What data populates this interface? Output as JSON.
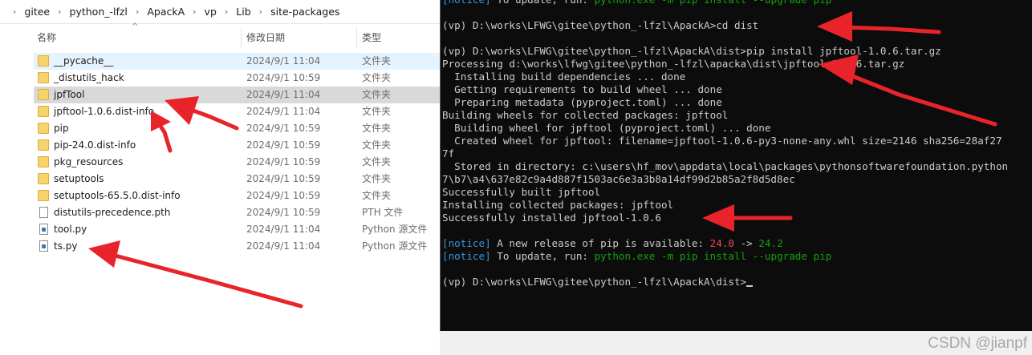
{
  "breadcrumb": [
    "gitee",
    "python_-lfzl",
    "ApackA",
    "vp",
    "Lib",
    "site-packages"
  ],
  "columns": {
    "name": "名称",
    "date": "修改日期",
    "type": "类型"
  },
  "files": [
    {
      "name": "__pycache__",
      "date": "2024/9/1 11:04",
      "type": "文件夹",
      "icon": "folder-icon",
      "state": "hover"
    },
    {
      "name": "_distutils_hack",
      "date": "2024/9/1 10:59",
      "type": "文件夹",
      "icon": "folder-icon",
      "state": ""
    },
    {
      "name": "jpfTool",
      "date": "2024/9/1 11:04",
      "type": "文件夹",
      "icon": "folder-icon",
      "state": "selected"
    },
    {
      "name": "jpftool-1.0.6.dist-info",
      "date": "2024/9/1 11:04",
      "type": "文件夹",
      "icon": "folder-icon",
      "state": ""
    },
    {
      "name": "pip",
      "date": "2024/9/1 10:59",
      "type": "文件夹",
      "icon": "folder-icon",
      "state": ""
    },
    {
      "name": "pip-24.0.dist-info",
      "date": "2024/9/1 10:59",
      "type": "文件夹",
      "icon": "folder-icon",
      "state": ""
    },
    {
      "name": "pkg_resources",
      "date": "2024/9/1 10:59",
      "type": "文件夹",
      "icon": "folder-icon",
      "state": ""
    },
    {
      "name": "setuptools",
      "date": "2024/9/1 10:59",
      "type": "文件夹",
      "icon": "folder-icon",
      "state": ""
    },
    {
      "name": "setuptools-65.5.0.dist-info",
      "date": "2024/9/1 10:59",
      "type": "文件夹",
      "icon": "folder-icon",
      "state": ""
    },
    {
      "name": "distutils-precedence.pth",
      "date": "2024/9/1 10:59",
      "type": "PTH 文件",
      "icon": "file-icon",
      "state": ""
    },
    {
      "name": "tool.py",
      "date": "2024/9/1 11:04",
      "type": "Python 源文件",
      "icon": "python-file-icon",
      "state": ""
    },
    {
      "name": "ts.py",
      "date": "2024/9/1 11:04",
      "type": "Python 源文件",
      "icon": "python-file-icon",
      "state": ""
    }
  ],
  "console": {
    "lines": [
      [
        {
          "t": "[notice]",
          "c": "cyan"
        },
        {
          "t": " To update, run: "
        },
        {
          "t": "python.exe -m pip install --upgrade pip",
          "c": "green"
        }
      ],
      [
        {
          "t": ""
        }
      ],
      [
        {
          "t": "(vp) D:\\works\\LFWG\\gitee\\python_-lfzl\\ApackA>cd dist"
        }
      ],
      [
        {
          "t": ""
        }
      ],
      [
        {
          "t": "(vp) D:\\works\\LFWG\\gitee\\python_-lfzl\\ApackA\\dist>pip install jpftool-1.0.6.tar.gz"
        }
      ],
      [
        {
          "t": "Processing d:\\works\\lfwg\\gitee\\python_-lfzl\\apacka\\dist\\jpftool-1.0.6.tar.gz"
        }
      ],
      [
        {
          "t": "  Installing build dependencies ... done"
        }
      ],
      [
        {
          "t": "  Getting requirements to build wheel ... done"
        }
      ],
      [
        {
          "t": "  Preparing metadata (pyproject.toml) ... done"
        }
      ],
      [
        {
          "t": "Building wheels for collected packages: jpftool"
        }
      ],
      [
        {
          "t": "  Building wheel for jpftool (pyproject.toml) ... done"
        }
      ],
      [
        {
          "t": "  Created wheel for jpftool: filename=jpftool-1.0.6-py3-none-any.whl size=2146 sha256=28af27"
        }
      ],
      [
        {
          "t": "7f"
        }
      ],
      [
        {
          "t": "  Stored in directory: c:\\users\\hf_mov\\appdata\\local\\packages\\pythonsoftwarefoundation.python"
        }
      ],
      [
        {
          "t": "7\\b7\\a4\\637e82c9a4d887f1503ac6e3a3b8a14df99d2b85a2f8d5d8ec"
        }
      ],
      [
        {
          "t": "Successfully built jpftool"
        }
      ],
      [
        {
          "t": "Installing collected packages: jpftool"
        }
      ],
      [
        {
          "t": "Successfully installed jpftool-1.0.6"
        }
      ],
      [
        {
          "t": ""
        }
      ],
      [
        {
          "t": "[notice]",
          "c": "cyan"
        },
        {
          "t": " A new release of pip is available: "
        },
        {
          "t": "24.0",
          "c": "red"
        },
        {
          "t": " -> "
        },
        {
          "t": "24.2",
          "c": "green"
        }
      ],
      [
        {
          "t": "[notice]",
          "c": "cyan"
        },
        {
          "t": " To update, run: "
        },
        {
          "t": "python.exe -m pip install --upgrade pip",
          "c": "green"
        }
      ],
      [
        {
          "t": ""
        }
      ],
      [
        {
          "t": "(vp) D:\\works\\LFWG\\gitee\\python_-lfzl\\ApackA\\dist>",
          "cursor": true
        }
      ]
    ]
  },
  "watermark": "CSDN @jianpf",
  "annotation_color": "#e8242a"
}
